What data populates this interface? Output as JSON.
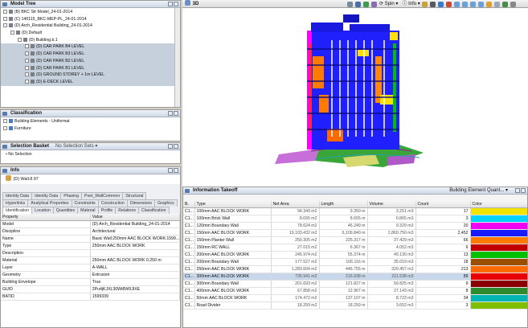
{
  "model_tree": {
    "title": "Model Tree",
    "items": [
      {
        "label": "(B) BKC Str Model_24-01-2014",
        "indent": 0,
        "toggle": "+"
      },
      {
        "label": "(C) 140115_BKC-MEP-PL_24-01-2014",
        "indent": 0,
        "toggle": "+"
      },
      {
        "label": "(D) Arch_Residential Building_24-01-2014",
        "indent": 0,
        "toggle": "-"
      },
      {
        "label": "(D) Default",
        "indent": 1,
        "toggle": "-"
      },
      {
        "label": "(D) Building.b.1",
        "indent": 2,
        "toggle": "-"
      },
      {
        "label": "(D) CAR PARK B4 LEVEL",
        "indent": 3,
        "toggle": "+"
      },
      {
        "label": "(D) CAR PARK B3 LEVEL",
        "indent": 3,
        "toggle": "+"
      },
      {
        "label": "(D) CAR PARK B2 LEVEL",
        "indent": 3,
        "toggle": "+"
      },
      {
        "label": "(D) CAR PARK B1 LEVEL",
        "indent": 3,
        "toggle": "+"
      },
      {
        "label": "(D) GROUND STOREY + 1m LEVEL",
        "indent": 3,
        "toggle": "+"
      },
      {
        "label": "(D) E-DECK LEVEL",
        "indent": 3,
        "toggle": "+"
      }
    ]
  },
  "classification": {
    "title": "Classification",
    "items": [
      {
        "label": "Building Elements - Uniformat"
      },
      {
        "label": "Furniture"
      }
    ]
  },
  "selection_basket": {
    "title": "Selection Basket",
    "sets_label": "No Selection Sets",
    "empty_label": "No Selection"
  },
  "info": {
    "title": "Info",
    "object": "(D) Wall.8.97",
    "tabs_row1": [
      "Identity Data",
      "Identity Data",
      "Phasing",
      "Pset_WallCommon",
      "Structural"
    ],
    "tabs_row2": [
      "Hyperlinks",
      "Analytical Properties",
      "Constraints",
      "Construction",
      "Dimensions",
      "Graphics"
    ],
    "tabs_row3": [
      "Identification",
      "Location",
      "Quantities",
      "Material",
      "Profile",
      "Relations",
      "Classification"
    ],
    "active_tab": "Identification",
    "columns": [
      "Property",
      "Value"
    ],
    "rows": [
      [
        "Model",
        "(D) Arch_Residential Building_24-01-2014"
      ],
      [
        "Discipline",
        "Architectural"
      ],
      [
        "Name",
        "Basic Wall:250mm AAC BLOCK WORK:1599..."
      ],
      [
        "Type",
        "250mm AAC BLOCK WORK"
      ],
      [
        "Description",
        ""
      ],
      [
        "Material",
        "250mm AAC BLOCK WORK 0.250 m"
      ],
      [
        "Layer",
        "A-WALL"
      ],
      [
        "Geometry",
        "Extrusion"
      ],
      [
        "Building Envelope",
        "True"
      ],
      [
        "GUID",
        "2Pu4jKJXL30Wt8W9JIXE"
      ],
      [
        "BATID",
        "1599339"
      ]
    ]
  },
  "view3d": {
    "title": "3D",
    "spin_label": "Spin",
    "info_label": "Info"
  },
  "takeoff": {
    "title": "Information Takeoff",
    "dropdown": "Building Element Quant...",
    "columns": [
      "B.",
      "Type",
      "Net Area",
      "Length",
      "Volume",
      "Count",
      "Color"
    ],
    "rows": [
      {
        "b": "C1...",
        "type": "100mm AAC BLOCK WORK",
        "area": "94.349 m2",
        "length": "9.350 m",
        "volume": "3.251 m3",
        "count": "17",
        "color": "#f2e300"
      },
      {
        "b": "C1...",
        "type": "100mm Brick Wall",
        "area": "8.655 m2",
        "length": "8.655 m",
        "volume": "0.865 m3",
        "count": "3",
        "color": "#00d2ff"
      },
      {
        "b": "C1...",
        "type": "120mm Boundary Wall",
        "area": "78.624 m2",
        "length": "46.249 m",
        "volume": "9.329 m3",
        "count": "20",
        "color": "#f200f2"
      },
      {
        "b": "C1...",
        "type": "150mm AAC BLOCK WORK",
        "area": "19,103.432 m2",
        "length": "6,109.840 m",
        "volume": "2,860.750 m3",
        "count": "2,452",
        "color": "#1a1aff"
      },
      {
        "b": "C1...",
        "type": "150mm Planter Wall",
        "area": "250.305 m2",
        "length": "225.317 m",
        "volume": "37.429 m3",
        "count": "66",
        "color": "#ff7a00"
      },
      {
        "b": "C1...",
        "type": "150mm RC WALL",
        "area": "27.015 m2",
        "length": "6.367 m",
        "volume": "4.052 m3",
        "count": "6",
        "color": "#c00000"
      },
      {
        "b": "C1...",
        "type": "200mm AAC BLOCK WORK",
        "area": "245.974 m2",
        "length": "55.374 m",
        "volume": "49.130 m3",
        "count": "13",
        "color": "#00c000"
      },
      {
        "b": "C1...",
        "type": "200mm Boundary Wall",
        "area": "177.527 m2",
        "length": "106.116 m",
        "volume": "35.019 m3",
        "count": "18",
        "color": "#9a4f00"
      },
      {
        "b": "C1...",
        "type": "250mm AAC BLOCK WORK",
        "area": "1,283.604 m2",
        "length": "446.755 m",
        "volume": "320.457 m3",
        "count": "213",
        "color": "#ff6a00"
      },
      {
        "b": "C1...",
        "type": "300mm AAC BLOCK WORK",
        "area": "735.941 m2",
        "length": "216.938 m",
        "volume": "211.538 m3",
        "count": "89",
        "color": "#e80000",
        "sel": true
      },
      {
        "b": "C1...",
        "type": "300mm Boundary Wall",
        "area": "201.693 m2",
        "length": "121.827 m",
        "volume": "59.825 m3",
        "count": "9",
        "color": "#8b0000"
      },
      {
        "b": "C1...",
        "type": "400mm AAC BLOCK WORK",
        "area": "67.858 m2",
        "length": "12.967 m",
        "volume": "27.143 m3",
        "count": "8",
        "color": "#2d8a2d"
      },
      {
        "b": "C1...",
        "type": "50mm AAC BLOCK WORK",
        "area": "174.472 m2",
        "length": "137.107 m",
        "volume": "8.723 m3",
        "count": "34",
        "color": "#00b4b4"
      },
      {
        "b": "C1...",
        "type": "Road Divider",
        "area": "18.259 m2",
        "length": "18.259 m",
        "volume": "3.652 m3",
        "count": "3",
        "color": "#7fbf00"
      }
    ]
  }
}
